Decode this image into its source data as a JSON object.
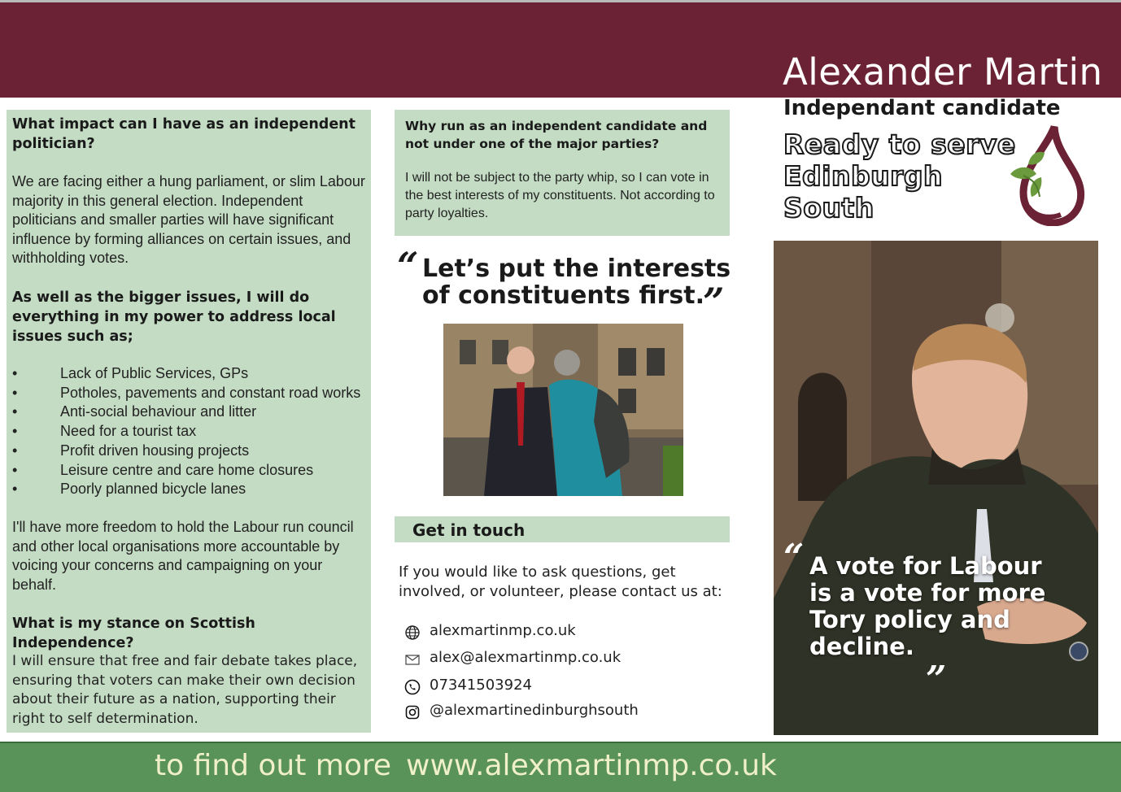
{
  "header": {
    "name": "Alexander Martin",
    "subtitle": "Independant candidate",
    "slogan_lines": [
      "Ready to serve",
      "Edinburgh",
      "South"
    ]
  },
  "left_panel": {
    "heading1": "What impact can I have as an independent politician?",
    "para1": "We are facing either a hung parliament, or slim Labour majority in this general election. Independent politicians and smaller parties will have significant influence by forming alliances on certain issues, and withholding votes.",
    "heading2": "As well as the bigger issues, I will do everything in my power to address local issues such as;",
    "issues": [
      "Lack of Public Services, GPs",
      "Potholes, pavements and constant road works",
      "Anti-social behaviour and litter",
      "Need for a tourist tax",
      "Profit driven housing projects",
      "Leisure centre and care home closures",
      "Poorly planned bicycle lanes"
    ],
    "para2": "I'll have more freedom to hold the Labour run council and other local organisations more accountable by voicing your concerns and campaigning on your behalf.",
    "heading3": "What is my stance on Scottish Independence?",
    "para3": "I will ensure that free and fair debate takes place, ensuring that voters can make their own decision about their future as a nation, supporting their right to self determination."
  },
  "middle": {
    "why_heading": "Why run as an independent candidate and not under one of the major parties?",
    "why_body": "I will not be subject to the party whip, so I can vote in the best interests of my constituents. Not according  to party loyalties.",
    "quote_open": "“",
    "quote_close": "”",
    "quote": "Let’s put the interests of constituents first.",
    "touch_title": "Get in touch",
    "touch_body": "If you would like to ask questions, get involved, or volunteer, please contact us at:",
    "contacts": [
      {
        "icon": "globe-icon",
        "text": "alexmartinmp.co.uk"
      },
      {
        "icon": "envelope-icon",
        "text": "alex@alexmartinmp.co.uk"
      },
      {
        "icon": "phone-icon",
        "text": "07341503924"
      },
      {
        "icon": "instagram-icon",
        "text": "@alexmartinedinburghsouth"
      }
    ]
  },
  "right": {
    "quote_open": "“",
    "quote_close": "”",
    "quote": "A vote for Labour is a vote for more Tory policy and decline."
  },
  "footer": {
    "prefix": "to find out more",
    "url": "www.alexmartinmp.co.uk"
  },
  "colors": {
    "maroon": "#6b2234",
    "panel_green": "#c4dcc4",
    "footer_green": "#5a935a",
    "footer_text": "#f0f0c8"
  }
}
